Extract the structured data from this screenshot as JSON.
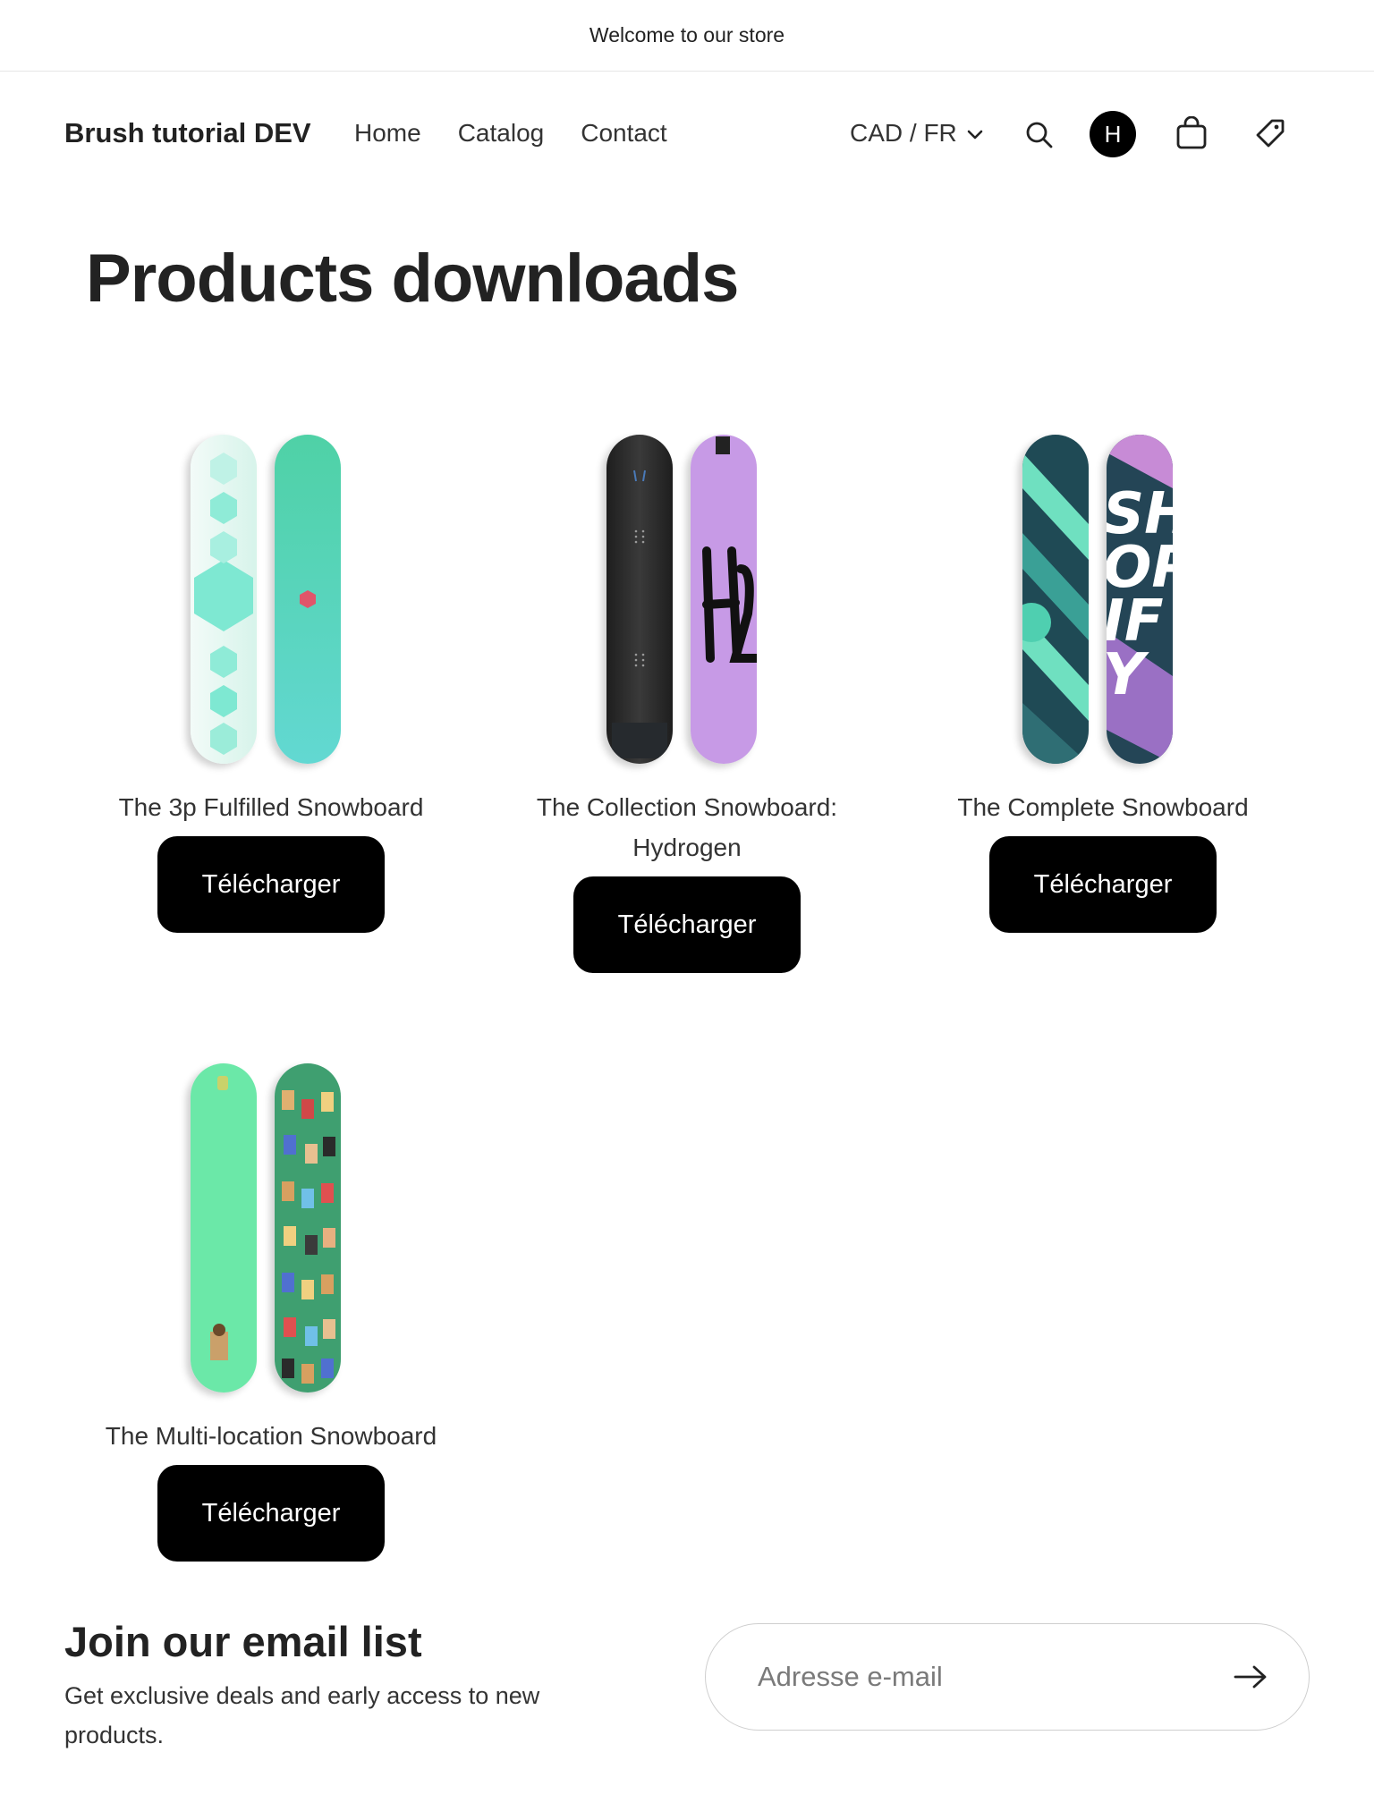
{
  "announcement": {
    "text": "Welcome to our store"
  },
  "header": {
    "brand": "Brush tutorial DEV",
    "nav": [
      {
        "label": "Home"
      },
      {
        "label": "Catalog"
      },
      {
        "label": "Contact"
      }
    ],
    "locale": "CAD / FR",
    "avatar_initial": "H",
    "icons": [
      "search-icon",
      "avatar",
      "bag-icon",
      "tag-icon"
    ]
  },
  "main": {
    "title": "Products downloads",
    "products": [
      {
        "title": "The 3p Fulfilled Snowboard",
        "button": "Télécharger"
      },
      {
        "title": "The Collection Snowboard: Hydrogen",
        "button": "Télécharger"
      },
      {
        "title": "The Complete Snowboard",
        "button": "Télécharger"
      },
      {
        "title": "The Multi-location Snowboard",
        "button": "Télécharger"
      }
    ]
  },
  "newsletter": {
    "title": "Join our email list",
    "description": "Get exclusive deals and early access to new products.",
    "email_placeholder": "Adresse e-mail"
  },
  "colors": {
    "button_bg": "#000000",
    "button_text": "#ffffff",
    "text": "#222222"
  }
}
